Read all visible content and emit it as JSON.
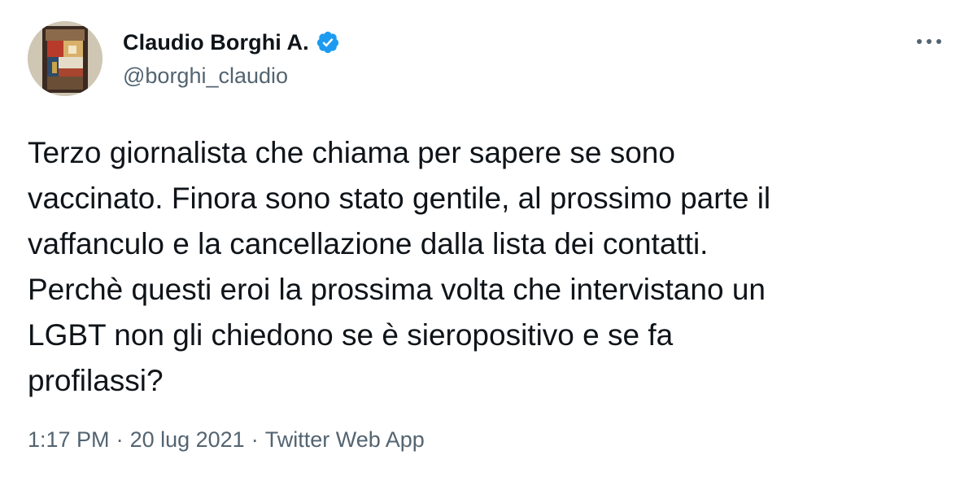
{
  "author": {
    "display_name": "Claudio Borghi A.",
    "handle": "@borghi_claudio",
    "verified": true,
    "avatar_icon": "avatar-painting-icon"
  },
  "more_icon": "more-horizontal-icon",
  "tweet": {
    "text": "Terzo giornalista che chiama per sapere se sono\nvaccinato. Finora sono stato gentile, al prossimo parte il\nvaffanculo e la cancellazione dalla lista dei contatti.\nPerchè questi eroi la prossima volta che intervistano un\nLGBT non gli chiedono se è sieropositivo e se fa\nprofilassi?"
  },
  "meta": {
    "time": "1:17 PM",
    "separator": "·",
    "date": "20 lug 2021",
    "source": "Twitter Web App"
  },
  "colors": {
    "text_primary": "#0f1419",
    "text_secondary": "#536471",
    "verified_blue": "#1d9bf0",
    "background": "#ffffff"
  }
}
